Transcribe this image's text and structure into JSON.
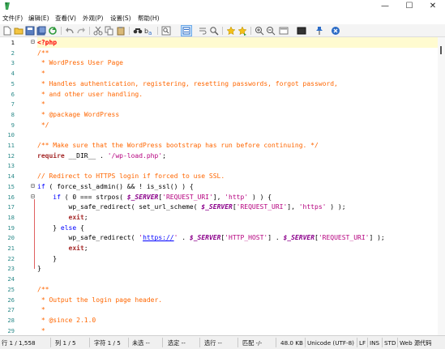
{
  "window": {
    "minimize_glyph": "—",
    "maximize_glyph": "☐",
    "close_glyph": "✕"
  },
  "menu": {
    "items": [
      "文件(F)",
      "编辑(E)",
      "查看(V)",
      "外观(P)",
      "设置(S)",
      "帮助(H)"
    ]
  },
  "toolbar": {
    "icons": [
      "new-file-icon",
      "open-file-icon",
      "save-icon",
      "save-all-icon",
      "reload-icon",
      "undo-icon",
      "redo-icon",
      "cut-icon",
      "copy-icon",
      "paste-icon",
      "find-icon",
      "replace-icon",
      "print-icon",
      "line-numbers-icon",
      "word-wrap-icon",
      "zoom-icon",
      "bookmark-icon",
      "bookmark-next-icon",
      "zoom-in-icon",
      "zoom-out-icon",
      "fullscreen-icon",
      "dark-screen-icon",
      "pin-icon",
      "exit-icon"
    ]
  },
  "editor": {
    "current_line": 1,
    "line_numbers": [
      "1",
      "2",
      "3",
      "4",
      "5",
      "6",
      "7",
      "8",
      "9",
      "10",
      "11",
      "12",
      "13",
      "14",
      "15",
      "16",
      "17",
      "18",
      "19",
      "20",
      "21",
      "22",
      "23",
      "24",
      "25",
      "26",
      "27",
      "28",
      "29"
    ],
    "lines": [
      [
        [
          "tag",
          "<?php"
        ]
      ],
      [
        [
          "cm",
          "/**"
        ]
      ],
      [
        [
          "cm",
          " * WordPress User Page"
        ]
      ],
      [
        [
          "cm",
          " *"
        ]
      ],
      [
        [
          "cm",
          " * Handles authentication, registering, resetting passwords, forgot password,"
        ]
      ],
      [
        [
          "cm",
          " * and other user handling."
        ]
      ],
      [
        [
          "cm",
          " *"
        ]
      ],
      [
        [
          "cm",
          " * @package WordPress"
        ]
      ],
      [
        [
          "cm",
          " */"
        ]
      ],
      [],
      [
        [
          "cm",
          "/** Make sure that the WordPress bootstrap has run before continuing. */"
        ]
      ],
      [
        [
          "kw2",
          "require"
        ],
        [
          "op",
          " __DIR__ . "
        ],
        [
          "str",
          "'/wp-load.php'"
        ],
        [
          "op",
          ";"
        ]
      ],
      [],
      [
        [
          "cm",
          "// Redirect to HTTPS login if forced to use SSL."
        ]
      ],
      [
        [
          "kw",
          "if"
        ],
        [
          "op",
          " ( force_ssl_admin() && ! is_ssl() ) {"
        ]
      ],
      [
        [
          "op",
          "    "
        ],
        [
          "kw",
          "if"
        ],
        [
          "op",
          " ( 0 === strpos( "
        ],
        [
          "var",
          "$_SERVER"
        ],
        [
          "op",
          "["
        ],
        [
          "str",
          "'REQUEST_URI'"
        ],
        [
          "op",
          "], "
        ],
        [
          "str",
          "'http'"
        ],
        [
          "op",
          " ) ) {"
        ]
      ],
      [
        [
          "op",
          "        wp_safe_redirect( set_url_scheme( "
        ],
        [
          "var",
          "$_SERVER"
        ],
        [
          "op",
          "["
        ],
        [
          "str",
          "'REQUEST_URI'"
        ],
        [
          "op",
          "], "
        ],
        [
          "str",
          "'https'"
        ],
        [
          "op",
          " ) );"
        ]
      ],
      [
        [
          "op",
          "        "
        ],
        [
          "kw2",
          "exit"
        ],
        [
          "op",
          ";"
        ]
      ],
      [
        [
          "op",
          "    } "
        ],
        [
          "kw",
          "else"
        ],
        [
          "op",
          " {"
        ]
      ],
      [
        [
          "op",
          "        wp_safe_redirect( "
        ],
        [
          "str",
          "'"
        ],
        [
          "link",
          "https://"
        ],
        [
          "str",
          "'"
        ],
        [
          "op",
          " . "
        ],
        [
          "var",
          "$_SERVER"
        ],
        [
          "op",
          "["
        ],
        [
          "str",
          "'HTTP_HOST'"
        ],
        [
          "op",
          "] . "
        ],
        [
          "var",
          "$_SERVER"
        ],
        [
          "op",
          "["
        ],
        [
          "str",
          "'REQUEST_URI'"
        ],
        [
          "op",
          "] );"
        ]
      ],
      [
        [
          "op",
          "        "
        ],
        [
          "kw2",
          "exit"
        ],
        [
          "op",
          ";"
        ]
      ],
      [
        [
          "op",
          "    }"
        ]
      ],
      [
        [
          "op",
          "}"
        ]
      ],
      [],
      [
        [
          "cm",
          "/**"
        ]
      ],
      [
        [
          "cm",
          " * Output the login page header."
        ]
      ],
      [
        [
          "cm",
          " *"
        ]
      ],
      [
        [
          "cm",
          " * @since 2.1.0"
        ]
      ],
      [
        [
          "cm",
          " *"
        ]
      ]
    ]
  },
  "status": {
    "line": "行 1 / 1,558",
    "col": "列 1 / 5",
    "chars": "字符 1 / 5",
    "ovr": "未选 --",
    "sel": "选定 --",
    "sel_lines": "选行 --",
    "match": "匹配 -/-",
    "size": "48.0 KB",
    "encoding": "Unicode (UTF-8)",
    "eol": "LF",
    "ins": "INS",
    "std": "STD",
    "scheme": "Web 源代码"
  },
  "colors": {
    "comment": "#ff6600",
    "keyword": "#0000ff",
    "string": "#b5007e",
    "variable": "#8b008b",
    "line_number": "#2b8a8a",
    "current_line_bg": "#fffbd0"
  }
}
